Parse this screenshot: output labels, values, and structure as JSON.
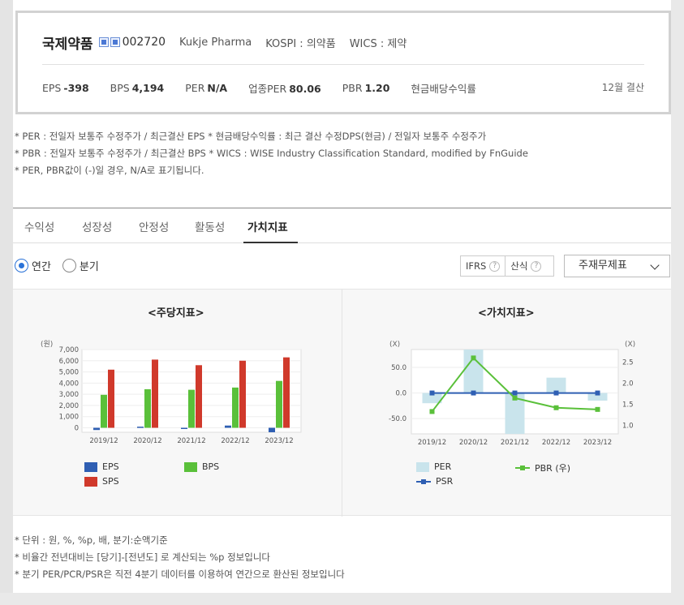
{
  "company": {
    "name": "국제약품",
    "code": "002720",
    "english_name": "Kukje Pharma",
    "market": "KOSPI : 의약품",
    "wics": "WICS : 제약"
  },
  "indicators": {
    "eps_label": "EPS",
    "eps_value": "-398",
    "bps_label": "BPS",
    "bps_value": "4,194",
    "per_label": "PER",
    "per_value": "N/A",
    "industry_per_label": "업종PER",
    "industry_per_value": "80.06",
    "pbr_label": "PBR",
    "pbr_value": "1.20",
    "dividend_label": "현금배당수익률",
    "settlement": "12월 결산"
  },
  "notes": [
    "* PER : 전일자 보통주 수정주가 / 최근결산 EPS * 현금배당수익률 : 최근 결산 수정DPS(현금) / 전일자 보통주 수정주가",
    "* PBR : 전일자 보통주 수정주가 / 최근결산 BPS * WICS : WISE Industry Classification Standard, modified by FnGuide",
    "* PER, PBR값이 (-)일 경우, N/A로 표기됩니다."
  ],
  "tabs": [
    "수익성",
    "성장성",
    "안정성",
    "활동성",
    "가치지표"
  ],
  "period": {
    "annual": "연간",
    "quarter": "분기"
  },
  "options": {
    "ifrs": "IFRS",
    "calc": "산식",
    "help": "?"
  },
  "select": {
    "value": "주재무제표"
  },
  "chart_data": [
    {
      "type": "bar",
      "title": "<주당지표>",
      "ylabel": "(원)",
      "categories": [
        "2019/12",
        "2020/12",
        "2021/12",
        "2022/12",
        "2023/12"
      ],
      "yticks": [
        "7,000",
        "6,000",
        "5,000",
        "4,000",
        "3,000",
        "2,000",
        "1,000",
        "0"
      ],
      "ylim": [
        -400,
        7000
      ],
      "grid": true,
      "legend_position": "bottom",
      "series": [
        {
          "name": "EPS",
          "color": "#2f5fb3",
          "values": [
            -200,
            100,
            -60,
            200,
            -398
          ]
        },
        {
          "name": "BPS",
          "color": "#5ac03a",
          "values": [
            2950,
            3450,
            3400,
            3600,
            4194
          ]
        },
        {
          "name": "SPS",
          "color": "#d0392b",
          "values": [
            5200,
            6100,
            5600,
            6000,
            6300
          ]
        }
      ]
    },
    {
      "type": "bar",
      "title": "<가치지표>",
      "ylabel_left": "(X)",
      "ylabel_right": "(X)",
      "categories": [
        "2019/12",
        "2020/12",
        "2021/12",
        "2022/12",
        "2023/12"
      ],
      "yticks_left": [
        "50.0",
        "0.0",
        "-50.0"
      ],
      "yticks_right": [
        "2.5",
        "2.0",
        "1.5",
        "1.0"
      ],
      "ylim_left": [
        -80,
        85
      ],
      "ylim_right": [
        0.8,
        2.8
      ],
      "grid": true,
      "legend_position": "bottom",
      "series": [
        {
          "name": "PER",
          "kind": "bar",
          "axis": "left",
          "color": "#c9e4ec",
          "values": [
            -20,
            85,
            -80,
            30,
            -15
          ]
        },
        {
          "name": "PBR (우)",
          "kind": "line",
          "axis": "right",
          "color": "#5ac03a",
          "values": [
            1.33,
            2.6,
            1.65,
            1.42,
            1.38
          ]
        },
        {
          "name": "PSR",
          "kind": "line",
          "axis": "left",
          "color": "#2f5fb3",
          "values": [
            0,
            0,
            0,
            0,
            0
          ]
        }
      ]
    }
  ],
  "bottom_notes": [
    "* 단위 : 원, %, %p, 배, 분기:순액기준",
    "* 비율간 전년대비는 [당기]-[전년도] 로 계산되는 %p 정보입니다",
    "* 분기 PER/PCR/PSR은 직전 4분기 데이터를 이용하여 연간으로 환산된 정보입니다"
  ]
}
